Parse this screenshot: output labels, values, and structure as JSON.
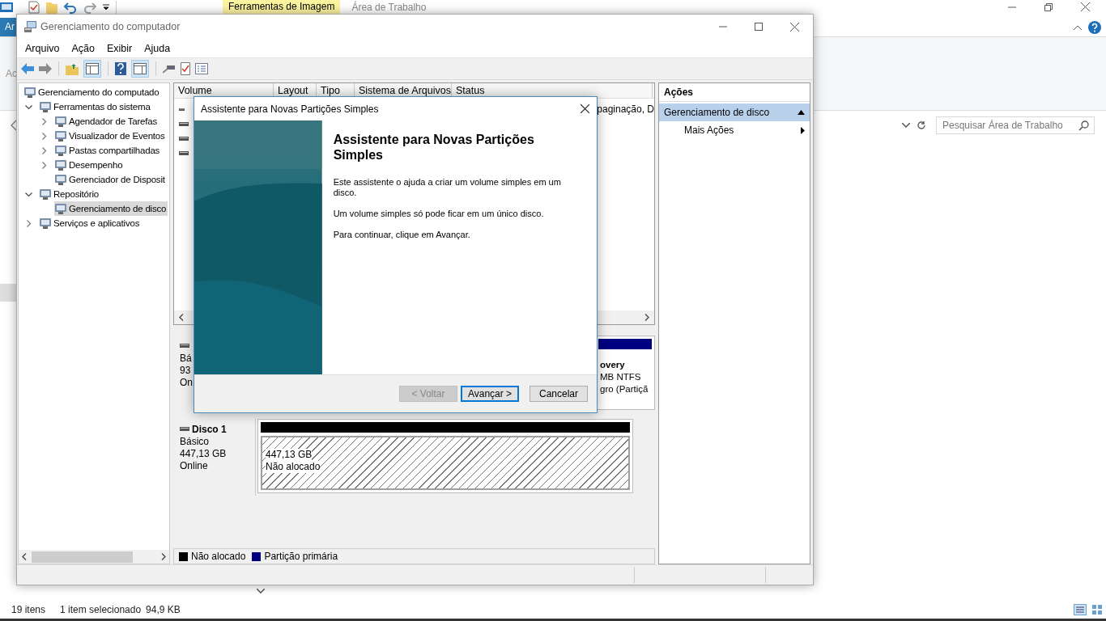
{
  "explorer": {
    "ribbon_tab": {
      "label": "Ar",
      "selected": true
    },
    "contextual_tab": "Ferramentas de Imagem",
    "title": "Área de Trabalho",
    "side_label": "Ac",
    "search": {
      "placeholder": "Pesquisar Área de Trabalho"
    },
    "status_bar": [
      "19 itens",
      "1 item selecionado",
      "94,9 KB"
    ]
  },
  "window": {
    "title": "Gerenciamento do computador"
  },
  "menu": [
    "Arquivo",
    "Ação",
    "Exibir",
    "Ajuda"
  ],
  "tree": [
    {
      "label": "Gerenciamento do computado",
      "selected": false,
      "children": [
        {
          "label": "Ferramentas do sistema",
          "expanded": true,
          "selected": false,
          "children": [
            {
              "label": "Agendador de Tarefas",
              "expanded": false,
              "selected": false
            },
            {
              "label": "Visualizador de Eventos",
              "expanded": false,
              "selected": false
            },
            {
              "label": "Pastas compartilhadas",
              "expanded": false,
              "selected": false
            },
            {
              "label": "Desempenho",
              "expanded": false,
              "selected": false
            },
            {
              "label": "Gerenciador de Disposit",
              "selected": false
            }
          ]
        },
        {
          "label": "Repositório",
          "expanded": true,
          "selected": false,
          "children": [
            {
              "label": "Gerenciamento de disco",
              "selected": true
            }
          ]
        },
        {
          "label": "Serviços e aplicativos",
          "expanded": false,
          "selected": false
        }
      ]
    }
  ],
  "volume_table": {
    "columns": [
      "Volume",
      "Layout",
      "Tipo",
      "Sistema de Arquivos",
      "Status"
    ],
    "rows": [
      {
        "kind": "volume",
        "status": "paginação, D"
      },
      {
        "kind": "volume"
      },
      {
        "kind": "volume"
      },
      {
        "kind": "volume"
      }
    ]
  },
  "disks": [
    {
      "info": [
        "Bá",
        "93",
        "On"
      ],
      "partitions": [
        {
          "kind": "partition",
          "color": "#000080",
          "lines": [
            "overy",
            "MB NTFS",
            "gro (Partiçã"
          ]
        }
      ]
    },
    {
      "name": "Disco 1",
      "info": [
        "Básico",
        "447,13 GB",
        "Online"
      ],
      "partitions": [
        {
          "kind": "unallocated",
          "color": "#000000",
          "lines": [
            "447,13 GB",
            "Não alocado"
          ]
        }
      ]
    }
  ],
  "legend": [
    {
      "label": "Não alocado",
      "color": "#000000"
    },
    {
      "label": "Partição primária",
      "color": "#000080"
    }
  ],
  "actions": {
    "title": "Ações",
    "items": [
      {
        "kind": "header",
        "label": "Gerenciamento de disco",
        "expanded": true
      },
      {
        "kind": "submenu",
        "label": "Mais Ações"
      }
    ]
  },
  "dialog": {
    "title": "Assistente para Novas Partições Simples",
    "heading": "Assistente para Novas Partições Simples",
    "paragraphs": [
      "Este assistente o ajuda a criar um volume simples em um disco.",
      "Um volume simples só pode ficar em um único disco.",
      "Para continuar, clique em Avançar."
    ],
    "buttons": [
      {
        "label": "< Voltar",
        "disabled": true,
        "default": false
      },
      {
        "label": "Avançar >",
        "disabled": false,
        "default": true
      },
      {
        "label": "Cancelar",
        "disabled": false,
        "default": false
      }
    ]
  }
}
